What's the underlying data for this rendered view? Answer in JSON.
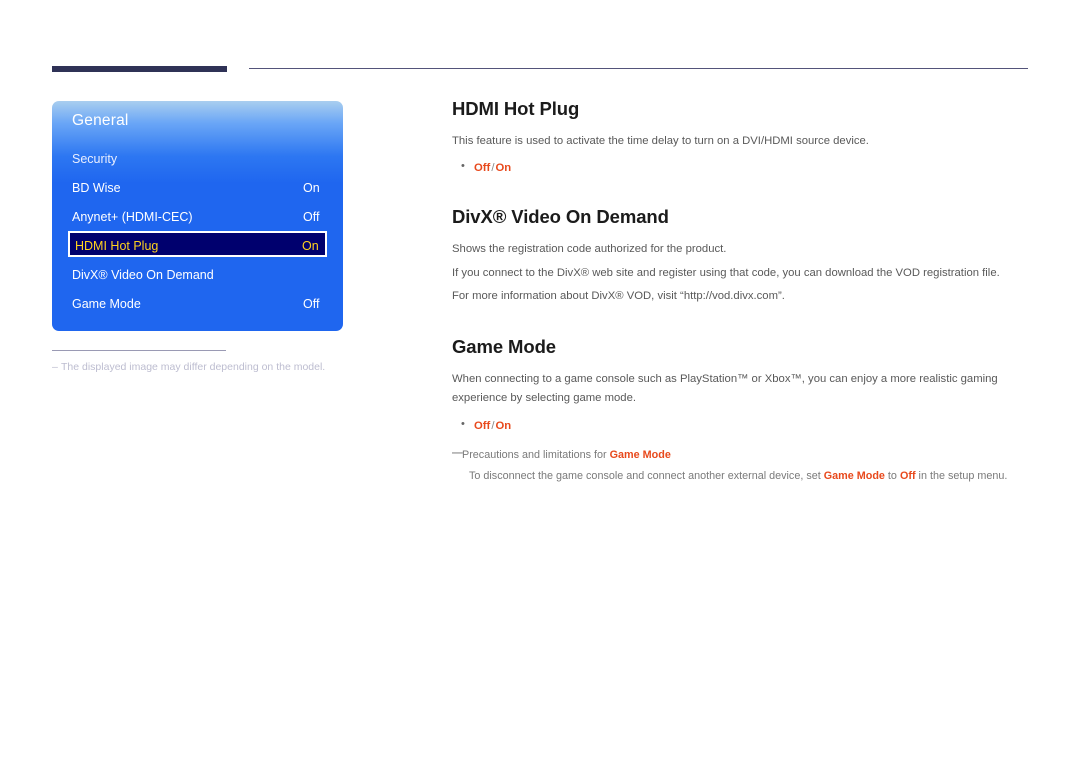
{
  "page": {
    "background": "#ffffff",
    "accent_rule_color": "#2f3256",
    "thin_rule_color": "#54547a"
  },
  "osd": {
    "title": "General",
    "panel_colors": {
      "gradient_top": "#a9ceef",
      "gradient_bottom": "#1f66ef",
      "selected_bg": "#00006e",
      "selected_text": "#ffd21e",
      "selected_border": "#ffffff"
    },
    "rows": [
      {
        "label": "Security",
        "value": ""
      },
      {
        "label": "BD Wise",
        "value": "On"
      },
      {
        "label": "Anynet+ (HDMI-CEC)",
        "value": "Off"
      },
      {
        "label": "HDMI Hot Plug",
        "value": "On",
        "selected": true
      },
      {
        "label": "DivX® Video On Demand",
        "value": ""
      },
      {
        "label": "Game Mode",
        "value": "Off"
      }
    ]
  },
  "image_note": {
    "dash": "–",
    "text": "The displayed image may differ depending on the model."
  },
  "sections": [
    {
      "heading": "HDMI Hot Plug",
      "paragraphs": [
        "This feature is used to activate the time delay to turn on a DVI/HDMI source device."
      ],
      "options": {
        "off": "Off",
        "separator": "/",
        "on": "On"
      }
    },
    {
      "heading": "DivX® Video On Demand",
      "paragraphs": [
        "Shows the registration code authorized for the product.",
        "If you connect to the DivX® web site and register using that code, you can download the VOD registration file.",
        "For more information about DivX® VOD, visit “http://vod.divx.com”."
      ]
    },
    {
      "heading": "Game Mode",
      "paragraphs": [
        "When connecting to a game console such as PlayStation™ or Xbox™, you can enjoy a more realistic gaming experience by selecting game mode."
      ],
      "options": {
        "off": "Off",
        "separator": "/",
        "on": "On"
      },
      "precaution": {
        "dash": "—",
        "lead": "Precautions and limitations for ",
        "highlight": "Game Mode",
        "sub_prefix": "To disconnect the game console and connect another external device, set ",
        "sub_hl1": "Game Mode",
        "sub_mid": " to ",
        "sub_hl2": "Off",
        "sub_suffix": " in the setup menu."
      }
    }
  ]
}
